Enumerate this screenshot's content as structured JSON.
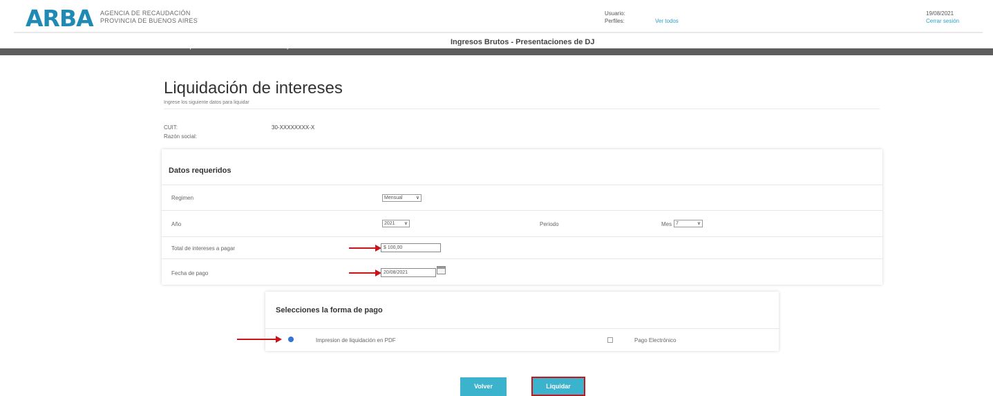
{
  "header": {
    "logo": "ARBA",
    "agency_line1": "AGENCIA DE RECAUDACIÓN",
    "agency_line2": "PROVINCIA DE BUENOS AIRES",
    "usuario_label": "Usuario:",
    "perfiles_label": "Perfiles:",
    "ver_todos": "Ver todos",
    "date": "19/08/2021",
    "cerrar_sesion": "Cerrar sesión"
  },
  "nav": {
    "title": "Ingresos Brutos - Presentaciones de DJ",
    "items": [
      "Presentación",
      "Consultas",
      "Liquidaciones",
      "Reimpresión",
      "Constancias",
      "Salir"
    ]
  },
  "page": {
    "title": "Liquidación de intereses",
    "subtitle": "Ingrese los siguiente datos para liquidar",
    "cuit_label": "CUIT:",
    "cuit_value": "30-XXXXXXXX-X",
    "razon_label": "Razón social:"
  },
  "datos": {
    "title": "Datos requeridos",
    "regimen_label": "Regimen",
    "regimen_value": "Mensual",
    "anio_label": "Año",
    "anio_value": "2021",
    "periodo_label": "Periodo",
    "mes_label": "Mes",
    "mes_value": "7",
    "total_label": "Total de intereses a pagar",
    "total_value": "$ 100,00",
    "fecha_label": "Fecha de pago",
    "fecha_value": "20/08/2021"
  },
  "pago": {
    "title": "Selecciones la forma de pago",
    "option1": "Impresion de liquidación en PDF",
    "option2": "Pago Electrónico"
  },
  "buttons": {
    "volver": "Volver",
    "liquidar": "Liquidar"
  },
  "colors": {
    "brand": "#1f8bb5",
    "button": "#3cb3cc",
    "annotation": "#c8141c",
    "nav": "#5d5d5d"
  }
}
